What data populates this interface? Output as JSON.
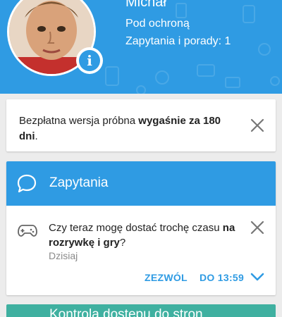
{
  "profile": {
    "name": "Michał",
    "status": "Pod ochroną",
    "requests_line": "Zapytania i porady: 1",
    "avatar_icon": "child-photo",
    "info_icon": "info-icon",
    "info_glyph": "i"
  },
  "trial": {
    "text_prefix": "Bezpłatna wersja próbna ",
    "text_bold": "wygaśnie za 180 dni",
    "text_suffix": ".",
    "close_icon": "close-icon"
  },
  "requests": {
    "title": "Zapytania",
    "title_icon": "chat-bubble-icon",
    "item": {
      "icon": "gamepad-icon",
      "question_prefix": "Czy teraz mogę dostać trochę czasu ",
      "question_bold": "na rozrywkę i gry",
      "question_suffix": "?",
      "time": "Dzisiaj",
      "allow_label": "ZEZWÓL",
      "until_label": "DO 13:59",
      "close_icon": "close-icon",
      "more_icon": "chevron-down-icon"
    }
  },
  "next_card": {
    "title": "Kontrola dostępu do stron"
  },
  "colors": {
    "header_blue": "#2f9be3",
    "accent_blue": "#2f9be3",
    "teal": "#3fb0a0",
    "background": "#ececec"
  }
}
